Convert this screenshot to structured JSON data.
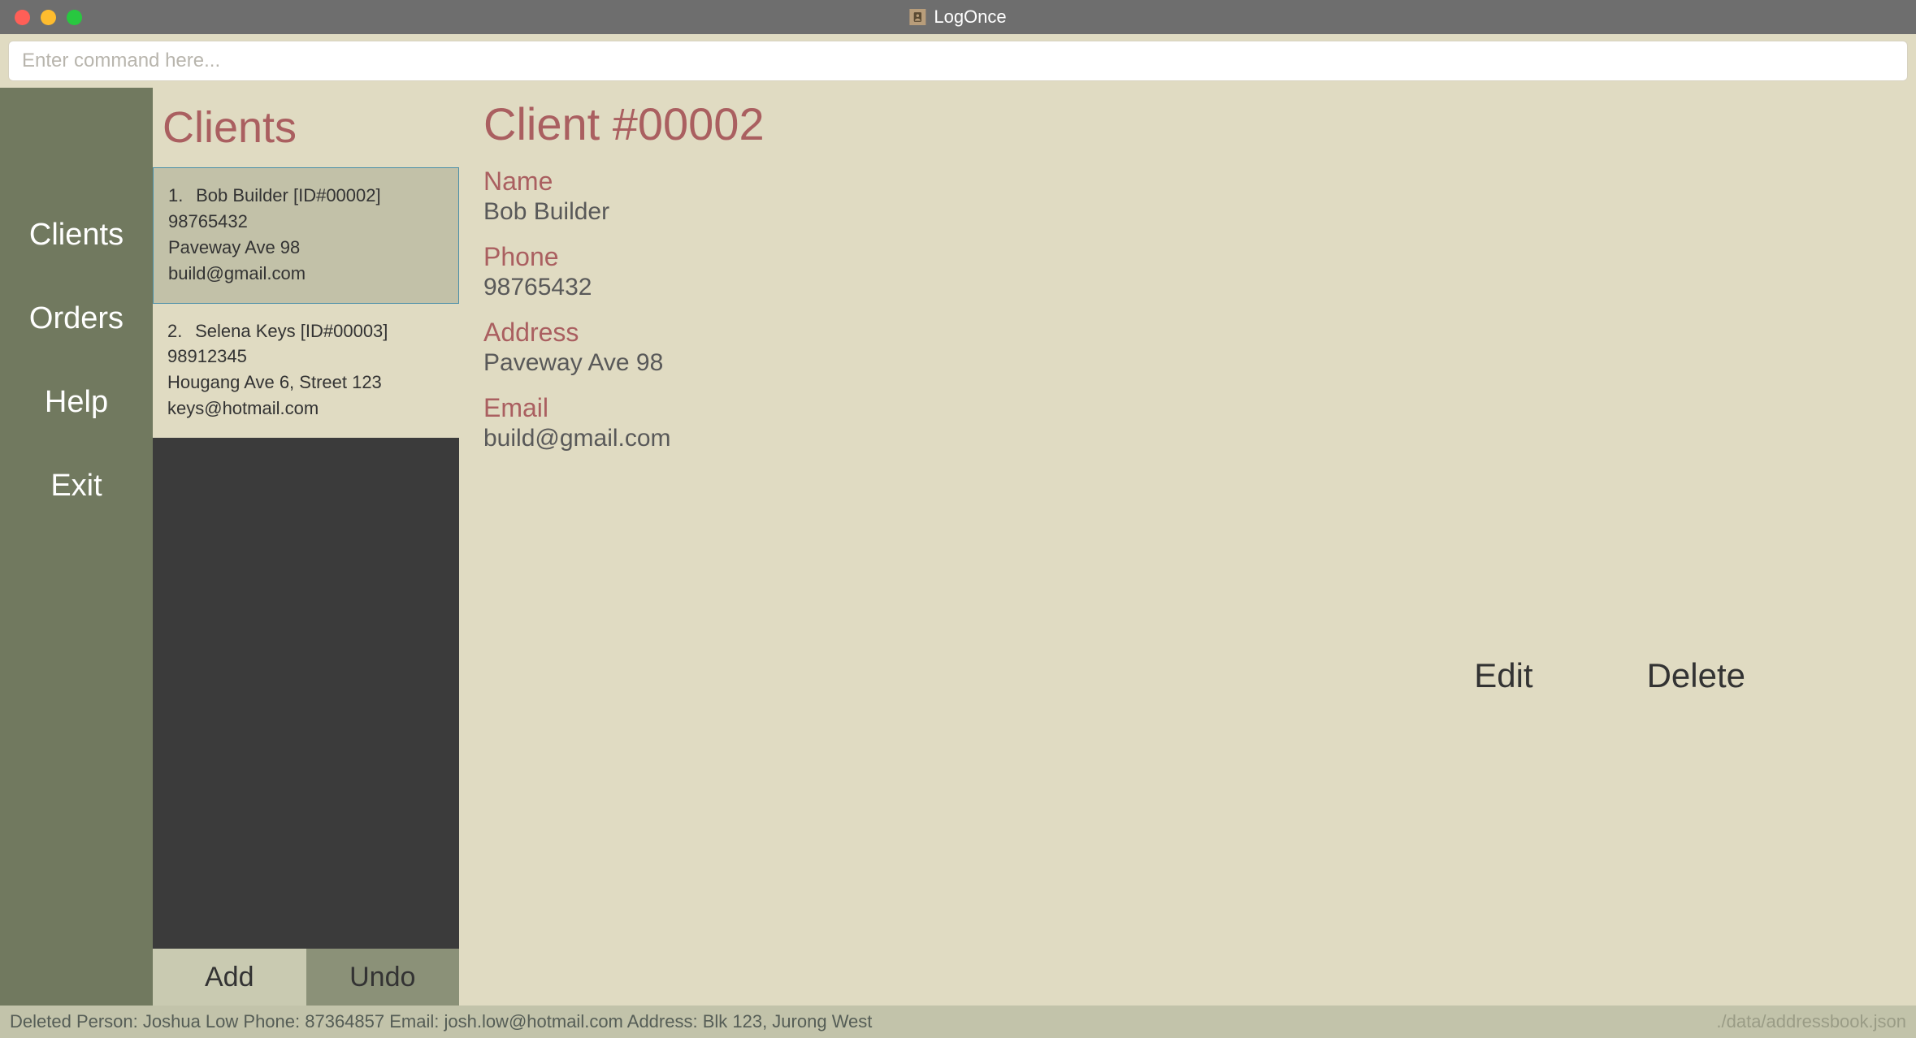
{
  "titlebar": {
    "title": "LogOnce"
  },
  "command": {
    "placeholder": "Enter command here..."
  },
  "sidebar": {
    "items": [
      {
        "label": "Clients"
      },
      {
        "label": "Orders"
      },
      {
        "label": "Help"
      },
      {
        "label": "Exit"
      }
    ]
  },
  "list": {
    "title": "Clients",
    "clients": [
      {
        "index": "1.",
        "name": "Bob Builder [ID#00002]",
        "phone": "98765432",
        "address": "Paveway Ave 98",
        "email": "build@gmail.com",
        "selected": true
      },
      {
        "index": "2.",
        "name": "Selena Keys [ID#00003]",
        "phone": "98912345",
        "address": "Hougang Ave 6, Street 123",
        "email": "keys@hotmail.com",
        "selected": false
      }
    ],
    "actions": {
      "add": "Add",
      "undo": "Undo"
    }
  },
  "detail": {
    "title": "Client #00002",
    "labels": {
      "name": "Name",
      "phone": "Phone",
      "address": "Address",
      "email": "Email"
    },
    "values": {
      "name": "Bob Builder",
      "phone": "98765432",
      "address": "Paveway Ave 98",
      "email": "build@gmail.com"
    },
    "actions": {
      "edit": "Edit",
      "delete": "Delete"
    }
  },
  "statusbar": {
    "left": "Deleted Person: Joshua Low Phone: 87364857 Email: josh.low@hotmail.com Address: Blk 123, Jurong West",
    "right": "./data/addressbook.json"
  }
}
